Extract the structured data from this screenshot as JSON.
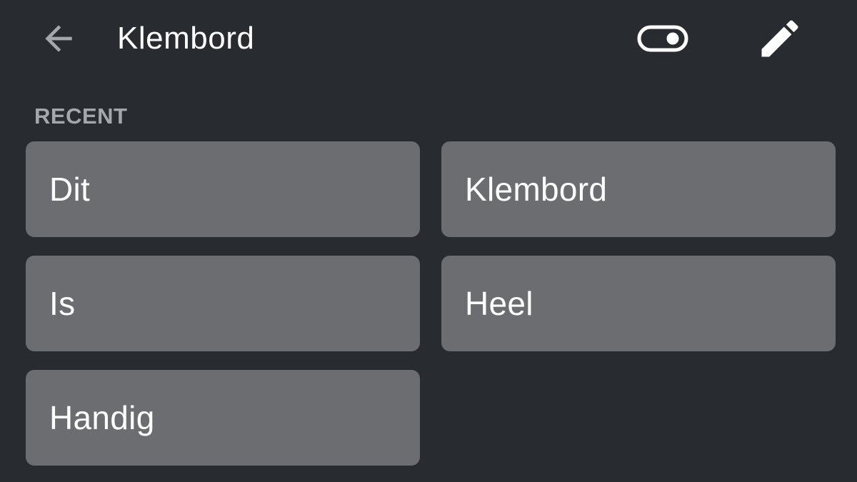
{
  "header": {
    "title": "Klembord",
    "back_icon": "arrow-back-icon",
    "toggle_icon": "toggle-icon",
    "edit_icon": "pencil-icon"
  },
  "recent": {
    "label": "RECENT",
    "items": [
      {
        "text": "Dit"
      },
      {
        "text": "Klembord"
      },
      {
        "text": "Is"
      },
      {
        "text": "Heel"
      },
      {
        "text": "Handig"
      }
    ]
  },
  "colors": {
    "background": "#282b30",
    "card": "#6b6d71",
    "section_label": "#a4a7ab",
    "text": "#ffffff"
  }
}
